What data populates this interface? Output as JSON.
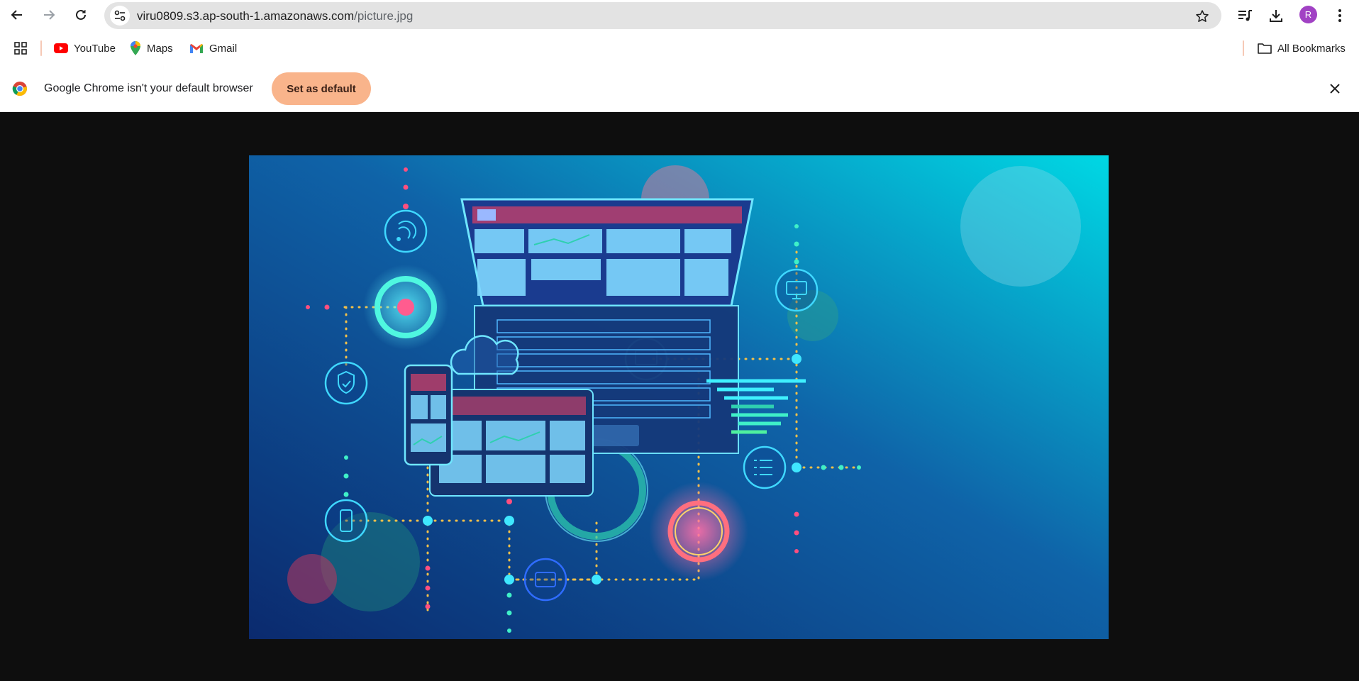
{
  "toolbar": {
    "url_host": "viru0809.s3.ap-south-1.amazonaws.com",
    "url_path": "/picture.jpg",
    "profile_initial": "R"
  },
  "bookmarks": {
    "items": [
      {
        "label": "YouTube",
        "icon": "youtube-icon"
      },
      {
        "label": "Maps",
        "icon": "maps-icon"
      },
      {
        "label": "Gmail",
        "icon": "gmail-icon"
      }
    ],
    "all_bookmarks": "All Bookmarks"
  },
  "infobar": {
    "message": "Google Chrome isn't your default browser",
    "button": "Set as default"
  },
  "colors": {
    "accent_button": "#f9b48b",
    "avatar": "#a142c4",
    "viewer_bg": "#0e0e0e"
  }
}
